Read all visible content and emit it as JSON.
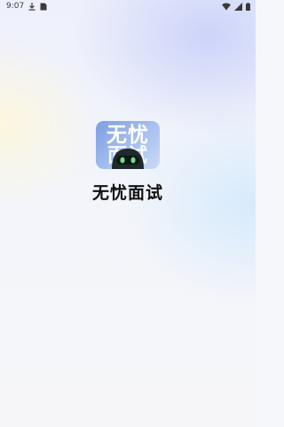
{
  "status_bar": {
    "time": "9:07",
    "icons": [
      "download-icon",
      "sim-card-icon",
      "wifi-icon",
      "cellular-signal-icon",
      "battery-icon"
    ]
  },
  "splash": {
    "logo_text": "无忧",
    "logo_text_lower": "面试",
    "app_name": "无忧面试"
  },
  "colors": {
    "logo_gradient_start": "#7f9ee2",
    "logo_gradient_end": "#cbdaf6",
    "robot_body": "#1f2a2a",
    "robot_eyes": "#6fdc8c",
    "title_text": "#111111"
  }
}
